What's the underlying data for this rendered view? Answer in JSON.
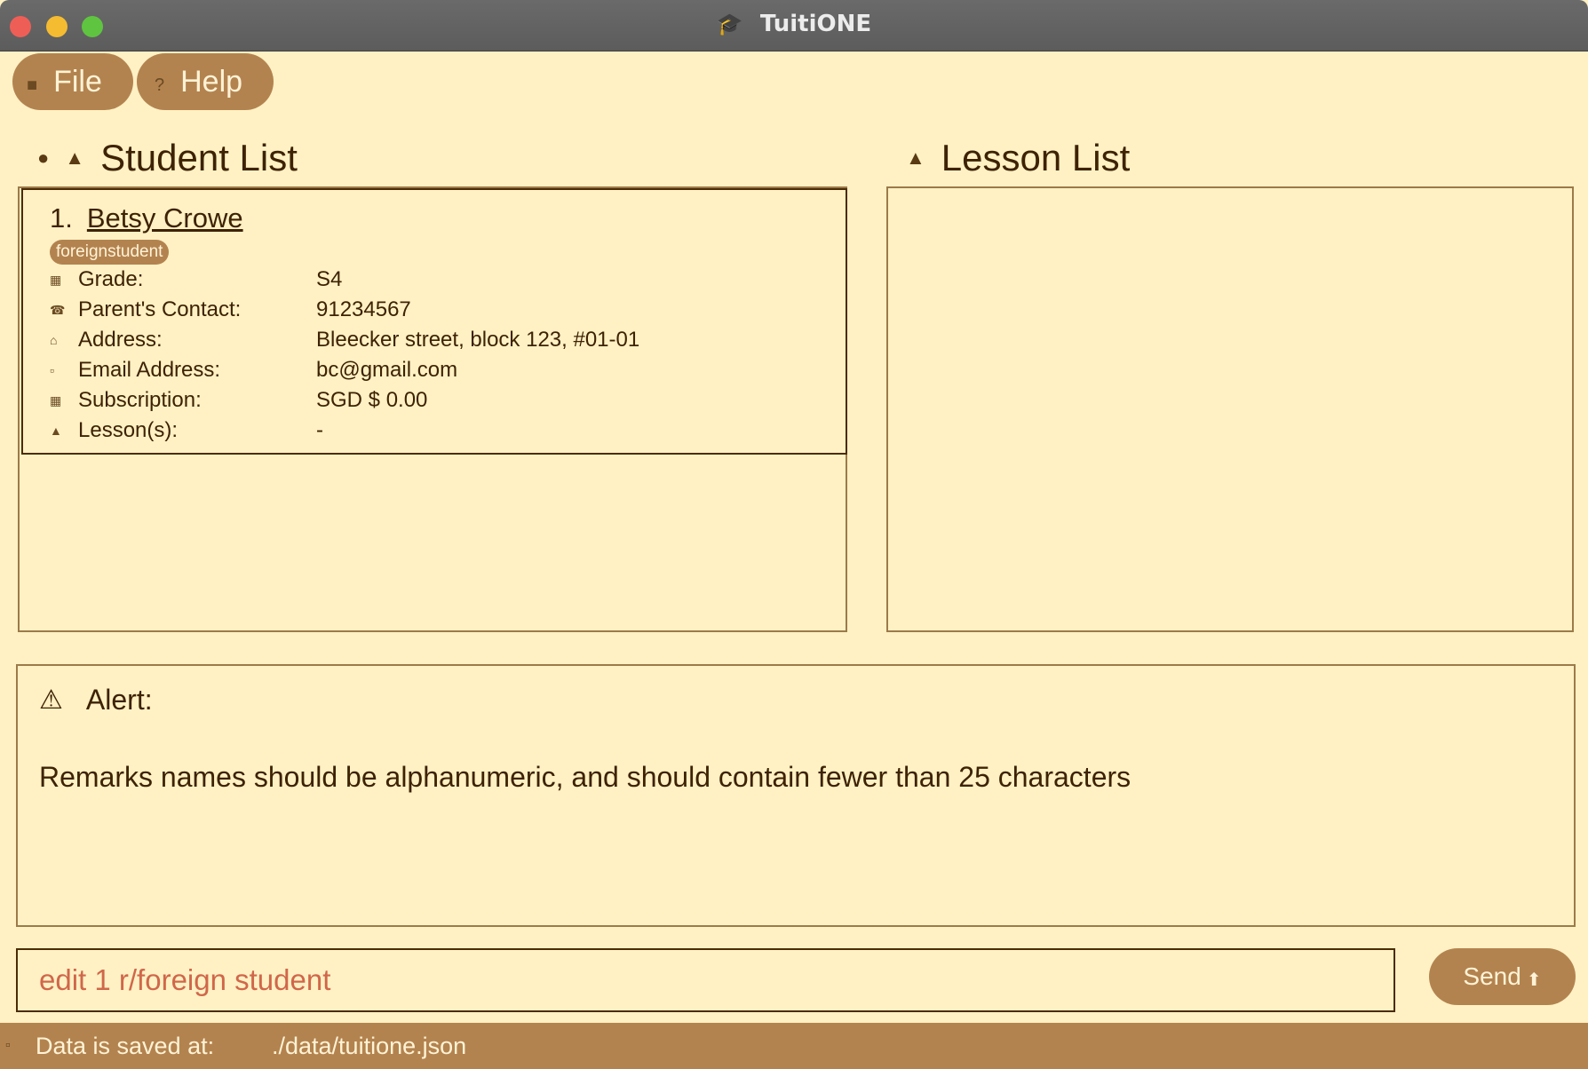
{
  "window": {
    "title": "TuitiONE",
    "title_icon": "graduation-cap-icon"
  },
  "menu": {
    "file_label": "File",
    "help_label": "Help"
  },
  "student_panel": {
    "title": "Student List",
    "students": [
      {
        "index": "1.",
        "name": "Betsy Crowe",
        "tag": "foreignstudent",
        "fields": {
          "grade_label": "Grade:",
          "grade": "S4",
          "contact_label": "Parent's Contact:",
          "contact": "91234567",
          "address_label": "Address:",
          "address": "Bleecker street, block 123, #01-01",
          "email_label": "Email Address:",
          "email": "bc@gmail.com",
          "subscription_label": "Subscription:",
          "subscription": "SGD $ 0.00",
          "lessons_label": "Lesson(s):",
          "lessons": "-"
        }
      }
    ]
  },
  "lesson_panel": {
    "title": "Lesson List",
    "lessons": []
  },
  "alert": {
    "title": "Alert:",
    "message": "Remarks names should be alphanumeric, and should contain fewer than 25 characters"
  },
  "command": {
    "value": "edit 1 r/foreign student",
    "send_label": "Send"
  },
  "status": {
    "label": "Data is saved at:",
    "path": "./data/tuitione.json"
  },
  "colors": {
    "background": "#fff1c4",
    "accent": "#b3834f",
    "text": "#4a2c06",
    "command_text": "#d0674a"
  }
}
